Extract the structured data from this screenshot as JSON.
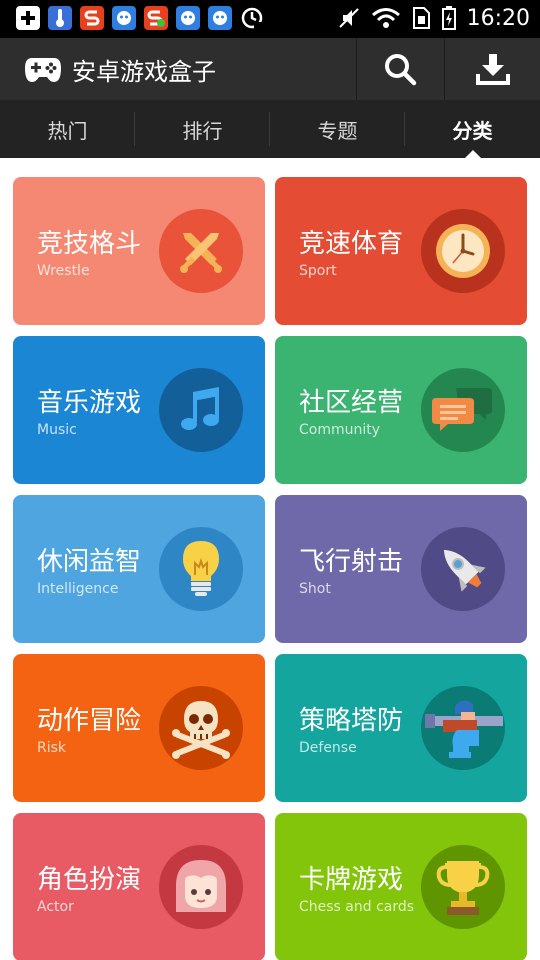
{
  "status_bar": {
    "time": "16:20"
  },
  "app_bar": {
    "title": "安卓游戏盒子"
  },
  "tabs": [
    {
      "label": "热门",
      "active": false
    },
    {
      "label": "排行",
      "active": false
    },
    {
      "label": "专题",
      "active": false
    },
    {
      "label": "分类",
      "active": true
    }
  ],
  "categories": [
    {
      "title": "竞技格斗",
      "subtitle": "Wrestle",
      "bg": "#f58872",
      "icon_bg": "#e9533a",
      "icon": "crossed-swords-icon"
    },
    {
      "title": "竞速体育",
      "subtitle": "Sport",
      "bg": "#e44d34",
      "icon_bg": "#b8321d",
      "icon": "clock-icon"
    },
    {
      "title": "音乐游戏",
      "subtitle": "Music",
      "bg": "#1b87d4",
      "icon_bg": "#135f9a",
      "icon": "music-note-icon"
    },
    {
      "title": "社区经营",
      "subtitle": "Community",
      "bg": "#3bb371",
      "icon_bg": "#248750",
      "icon": "chat-bubbles-icon"
    },
    {
      "title": "休闲益智",
      "subtitle": "Intelligence",
      "bg": "#4ea5df",
      "icon_bg": "#2f86c4",
      "icon": "light-bulb-icon"
    },
    {
      "title": "飞行射击",
      "subtitle": "Shot",
      "bg": "#6f69a9",
      "icon_bg": "#504a87",
      "icon": "rocket-icon"
    },
    {
      "title": "动作冒险",
      "subtitle": "Risk",
      "bg": "#f36312",
      "icon_bg": "#c94300",
      "icon": "skull-icon"
    },
    {
      "title": "策略塔防",
      "subtitle": "Defense",
      "bg": "#13a59e",
      "icon_bg": "#0a7b75",
      "icon": "soldier-icon"
    },
    {
      "title": "角色扮演",
      "subtitle": "Actor",
      "bg": "#e85b64",
      "icon_bg": "#c43842",
      "icon": "girl-face-icon"
    },
    {
      "title": "卡牌游戏",
      "subtitle": "Chess and cards",
      "bg": "#82c50a",
      "icon_bg": "#5f9500",
      "icon": "trophy-icon"
    }
  ]
}
